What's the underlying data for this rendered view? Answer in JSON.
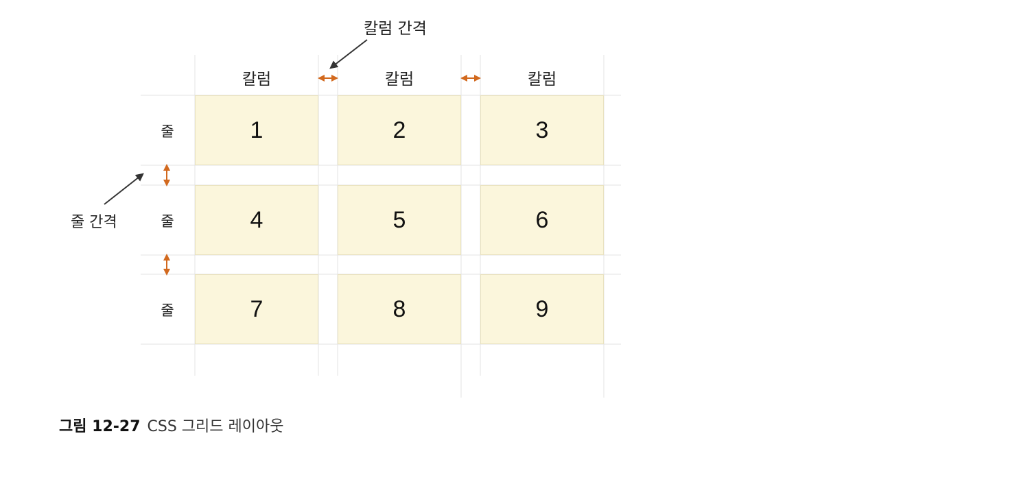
{
  "column_gap_label": "칼럼 간격",
  "row_gap_label": "줄 간격",
  "columns": [
    "칼럼",
    "칼럼",
    "칼럼"
  ],
  "rows": [
    "줄",
    "줄",
    "줄"
  ],
  "cells": [
    "1",
    "2",
    "3",
    "4",
    "5",
    "6",
    "7",
    "8",
    "9"
  ],
  "caption": {
    "figure_number": "그림 12-27",
    "text": "CSS 그리드 레이아웃"
  },
  "colors": {
    "cell_fill": "#fbf6dc",
    "gap_arrow": "#d2691e",
    "guide_line": "#e3e3e3",
    "pointer_arrow": "#333333"
  }
}
